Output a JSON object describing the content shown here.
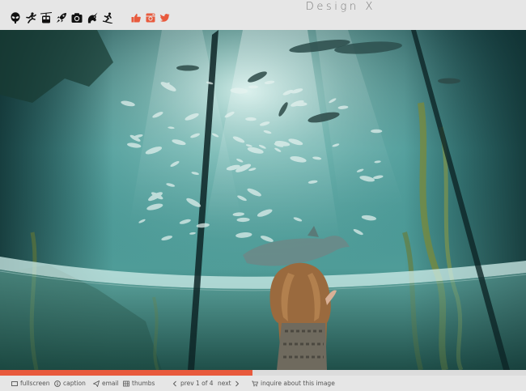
{
  "site": {
    "title": "Design X"
  },
  "nav_icons": [
    "alien-icon",
    "runner-icon",
    "cable-car-icon",
    "rocket-icon",
    "camera-icon",
    "unicorn-icon",
    "skier-icon"
  ],
  "social_icons": [
    "thumbs-up-icon",
    "instagram-icon",
    "twitter-icon"
  ],
  "colors": {
    "accent": "#e85a3d",
    "bar": "#e6e6e6",
    "text": "#555555",
    "title": "#7a7a7a"
  },
  "slideshow": {
    "progress": 0.48,
    "current": "1",
    "total": "4",
    "counter_sep": "of"
  },
  "controls": {
    "fullscreen": "fullscreen",
    "caption": "caption",
    "email": "email",
    "thumbs": "thumbs",
    "prev": "prev",
    "next": "next",
    "inquire": "inquire about this image"
  }
}
